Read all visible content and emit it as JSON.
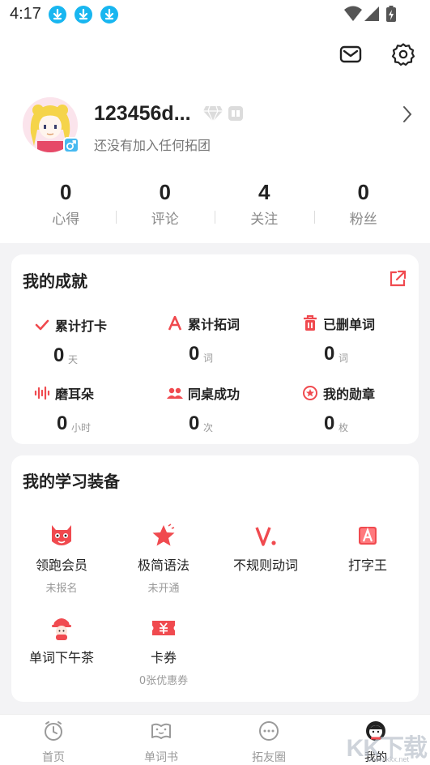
{
  "status_bar": {
    "time": "4:17",
    "notification_icons": [
      "download-icon",
      "download-icon",
      "download-icon"
    ],
    "system_icons": [
      "wifi-icon",
      "signal-icon",
      "battery-charging-icon"
    ]
  },
  "header": {
    "icons": [
      "mail-icon",
      "gear-icon"
    ]
  },
  "profile": {
    "username": "123456d...",
    "team_status": "还没有加入任何拓团",
    "gender": "male",
    "accent": "#47b9f0"
  },
  "stats": [
    {
      "value": "0",
      "label": "心得"
    },
    {
      "value": "0",
      "label": "评论"
    },
    {
      "value": "4",
      "label": "关注"
    },
    {
      "value": "0",
      "label": "粉丝"
    }
  ],
  "achievements": {
    "title": "我的成就",
    "items": [
      {
        "icon": "check-icon",
        "label": "累计打卡",
        "value": "0",
        "unit": "天"
      },
      {
        "icon": "letter-a-icon",
        "label": "累计拓词",
        "value": "0",
        "unit": "词"
      },
      {
        "icon": "trash-icon",
        "label": "已删单词",
        "value": "0",
        "unit": "词"
      },
      {
        "icon": "sound-wave-icon",
        "label": "磨耳朵",
        "value": "0",
        "unit": "小时"
      },
      {
        "icon": "people-icon",
        "label": "同桌成功",
        "value": "0",
        "unit": "次"
      },
      {
        "icon": "medal-icon",
        "label": "我的勋章",
        "value": "0",
        "unit": "枚"
      }
    ]
  },
  "equipment": {
    "title": "我的学习装备",
    "items": [
      {
        "icon": "monster-icon",
        "label": "领跑会员",
        "sub": "未报名"
      },
      {
        "icon": "star-icon",
        "label": "极简语法",
        "sub": "未开通"
      },
      {
        "icon": "verb-v-icon",
        "label": "不规则动词",
        "sub": ""
      },
      {
        "icon": "typing-a-icon",
        "label": "打字王",
        "sub": ""
      },
      {
        "icon": "tea-mascot-icon",
        "label": "单词下午茶",
        "sub": ""
      },
      {
        "icon": "coupon-icon",
        "label": "卡券",
        "sub": "0张优惠券"
      }
    ]
  },
  "bottom_nav": [
    {
      "icon": "clock-home-icon",
      "label": "首页",
      "active": false
    },
    {
      "icon": "book-icon",
      "label": "单词书",
      "active": false
    },
    {
      "icon": "chat-bubble-icon",
      "label": "拓友圈",
      "active": false
    },
    {
      "icon": "avatar-icon",
      "label": "我的",
      "active": true
    }
  ],
  "watermark": {
    "text": "KK下载",
    "sub": "www.kkx.net"
  },
  "colors": {
    "accent_red": "#f04a4f",
    "text_dark": "#222222",
    "text_grey": "#8a8a8a",
    "background": "#f3f3f5"
  }
}
